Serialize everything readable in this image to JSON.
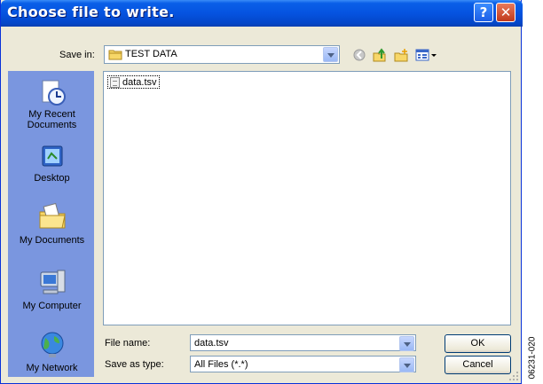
{
  "window": {
    "title": "Choose file to write.",
    "help_glyph": "?",
    "close_glyph": "✕"
  },
  "save_in": {
    "label": "Save in:",
    "value": "TEST DATA",
    "toolbar_icons": [
      "back-icon",
      "up-folder-icon",
      "new-folder-icon",
      "view-menu-icon"
    ]
  },
  "places": [
    {
      "label": "My Recent Documents",
      "icon": "my-recent-documents-icon"
    },
    {
      "label": "Desktop",
      "icon": "desktop-icon"
    },
    {
      "label": "My Documents",
      "icon": "my-documents-icon"
    },
    {
      "label": "My Computer",
      "icon": "my-computer-icon"
    },
    {
      "label": "My Network",
      "icon": "my-network-icon"
    }
  ],
  "files": [
    {
      "name": "data.tsv"
    }
  ],
  "file_name": {
    "label": "File name:",
    "value": "data.tsv"
  },
  "save_as_type": {
    "label": "Save as type:",
    "value": "All Files (*.*)"
  },
  "buttons": {
    "ok": "OK",
    "cancel": "Cancel"
  },
  "figure_id": "06231-020",
  "colors": {
    "titlebar": "#0553e0",
    "places_bar": "#7a96df",
    "dialog_bg": "#ece9d8",
    "close_button": "#c0391b"
  }
}
